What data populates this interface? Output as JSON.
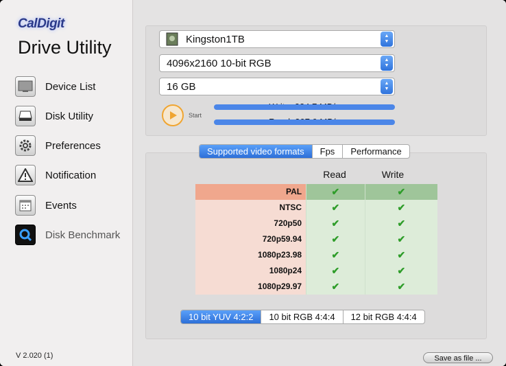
{
  "brand": {
    "logo": "CalDigit",
    "app_title": "Drive Utility",
    "version": "V 2.020 (1)"
  },
  "sidebar": {
    "items": [
      {
        "label": "Device List",
        "icon": "monitor-icon"
      },
      {
        "label": "Disk Utility",
        "icon": "disk-icon"
      },
      {
        "label": "Preferences",
        "icon": "gear-icon"
      },
      {
        "label": "Notification",
        "icon": "warning-icon"
      },
      {
        "label": "Events",
        "icon": "calendar-icon"
      },
      {
        "label": "Disk Benchmark",
        "icon": "benchmark-icon"
      }
    ]
  },
  "benchmark": {
    "drive_select": "Kingston1TB",
    "resolution_select": "4096x2160 10-bit RGB",
    "size_select": "16 GB",
    "start_label": "Start",
    "write_label": "Write: 234.7 MB/s",
    "read_label": "Read: 307.9 MB/s",
    "write_progress": 1.0,
    "read_progress": 1.0
  },
  "tabs": [
    "Supported video formats",
    "Fps",
    "Performance"
  ],
  "table": {
    "headers": [
      "Read",
      "Write"
    ],
    "rows": [
      {
        "format": "PAL",
        "read": "✔",
        "write": "✔"
      },
      {
        "format": "NTSC",
        "read": "✔",
        "write": "✔"
      },
      {
        "format": "720p50",
        "read": "✔",
        "write": "✔"
      },
      {
        "format": "720p59.94",
        "read": "✔",
        "write": "✔"
      },
      {
        "format": "1080p23.98",
        "read": "✔",
        "write": "✔"
      },
      {
        "format": "1080p24",
        "read": "✔",
        "write": "✔"
      },
      {
        "format": "1080p29.97",
        "read": "✔",
        "write": "✔"
      }
    ]
  },
  "bit_tabs": [
    "10 bit YUV 4:2:2",
    "10 bit RGB 4:4:4",
    "12 bit RGB 4:4:4"
  ],
  "save_button": "Save as file ...",
  "colors": {
    "accent": "#2d6fd8",
    "check": "#2f9d2a",
    "start": "#f0a531"
  }
}
